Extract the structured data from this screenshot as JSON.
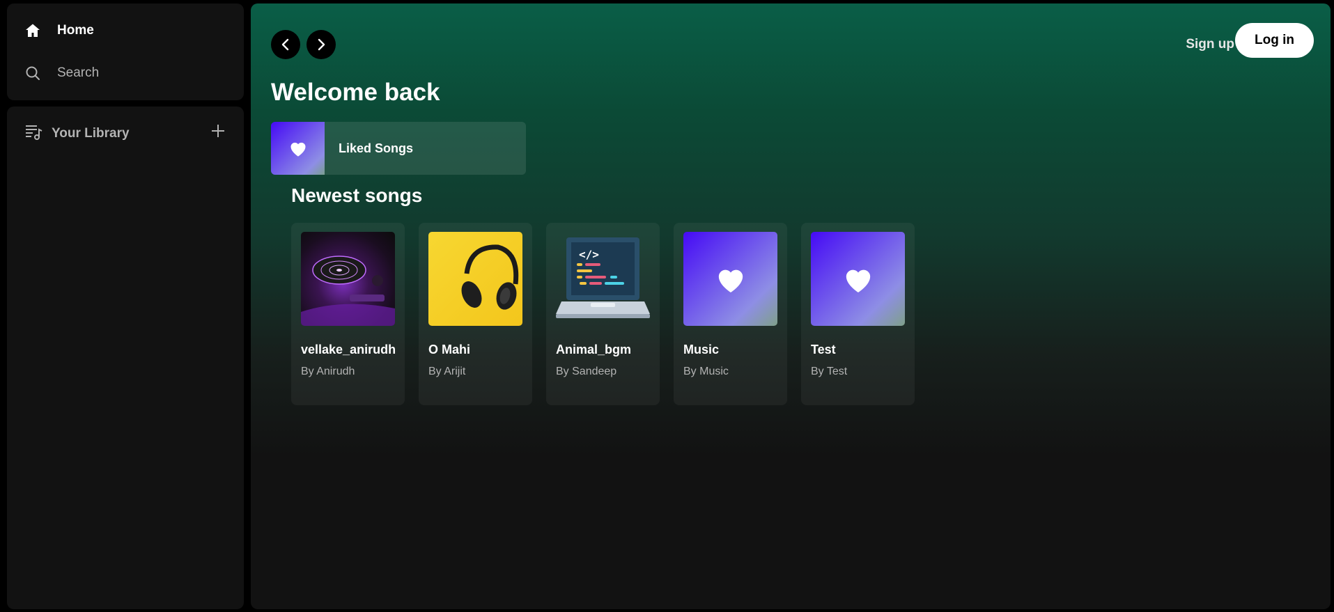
{
  "sidebar": {
    "nav": [
      {
        "label": "Home",
        "icon": "home-icon"
      },
      {
        "label": "Search",
        "icon": "search-icon"
      }
    ],
    "library": {
      "label": "Your Library",
      "icon": "library-icon",
      "add_icon": "plus-icon"
    }
  },
  "header": {
    "signup_label": "Sign up",
    "login_label": "Log in"
  },
  "main": {
    "greeting": "Welcome back",
    "liked": {
      "label": "Liked Songs",
      "icon": "heart-icon"
    },
    "section_title": "Newest songs",
    "songs": [
      {
        "title": "vellake_anirudh",
        "artist": "By Anirudh",
        "art": "dj-turntable"
      },
      {
        "title": "O Mahi",
        "artist": "By Arijit",
        "art": "headphones-yellow"
      },
      {
        "title": "Animal_bgm",
        "artist": "By Sandeep",
        "art": "laptop-code"
      },
      {
        "title": "Music",
        "artist": "By Music",
        "art": "heart-gradient"
      },
      {
        "title": "Test",
        "artist": "By Test",
        "art": "heart-gradient"
      }
    ]
  },
  "colors": {
    "accent_green": "#0a5e47",
    "background": "#121212",
    "liked_gradient_start": "#450af5",
    "liked_gradient_end": "#8e8ee5"
  }
}
